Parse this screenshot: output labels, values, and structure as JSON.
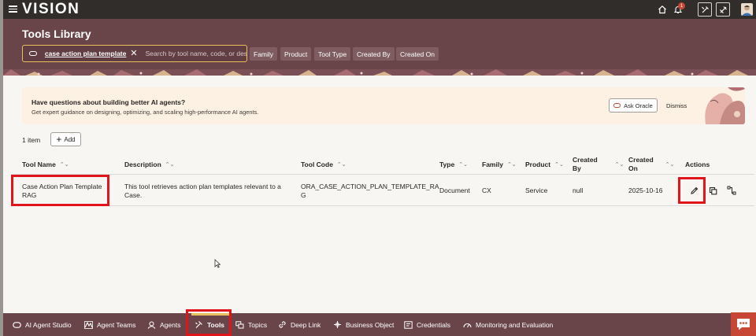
{
  "app": {
    "brand": "VISION"
  },
  "topbar": {
    "notification_count": "1",
    "icons": [
      "hamburger-icon",
      "home-icon",
      "bell-icon",
      "tool-icon",
      "tool-alt-icon",
      "avatar"
    ]
  },
  "header": {
    "title": "Tools Library",
    "search": {
      "chip_label": "case action plan template",
      "placeholder": "Search by tool name, code, or description"
    },
    "filters": [
      "Family",
      "Product",
      "Tool Type",
      "Created By",
      "Created On"
    ]
  },
  "banner": {
    "title": "Have questions about building better AI agents?",
    "subtitle": "Get expert guidance on designing, optimizing, and scaling high-performance AI agents.",
    "ask_label": "Ask Oracle",
    "dismiss_label": "Dismiss"
  },
  "list": {
    "count_label": "1 item",
    "add_label": "Add"
  },
  "table": {
    "headers": {
      "tool_name": "Tool Name",
      "description": "Description",
      "tool_code": "Tool Code",
      "type": "Type",
      "family": "Family",
      "product": "Product",
      "created_by_1": "Created",
      "created_by_2": "By",
      "created_on_1": "Created",
      "created_on_2": "On",
      "actions": "Actions"
    },
    "rows": [
      {
        "tool_name_1": "Case Action Plan Template",
        "tool_name_2": "RAG",
        "description_1": "This tool retrieves action plan templates relevant to a",
        "description_2": "Case.",
        "tool_code_1": "ORA_CASE_ACTION_PLAN_TEMPLATE_RA",
        "tool_code_2": "G",
        "type": "Document",
        "family": "CX",
        "product": "Service",
        "created_by": "null",
        "created_on": "2025-10-16"
      }
    ]
  },
  "bottom_nav": {
    "items": [
      {
        "label": "AI Agent Studio",
        "icon": "studio-icon"
      },
      {
        "label": "Agent Teams",
        "icon": "agent-teams-icon"
      },
      {
        "label": "Agents",
        "icon": "agents-icon"
      },
      {
        "label": "Tools",
        "icon": "tools-icon",
        "active": true
      },
      {
        "label": "Topics",
        "icon": "topics-icon"
      },
      {
        "label": "Deep Link",
        "icon": "link-icon"
      },
      {
        "label": "Business Object",
        "icon": "business-object-icon"
      },
      {
        "label": "Credentials",
        "icon": "credentials-icon"
      },
      {
        "label": "Monitoring and Evaluation",
        "icon": "monitoring-icon"
      }
    ]
  },
  "colors": {
    "header_bg": "#694449",
    "topbar_bg": "#312d2a",
    "search_border": "#e8c15e",
    "accent_red": "#c74634",
    "highlight_red": "#e0151c",
    "banner_bg": "#fcf1e3"
  }
}
